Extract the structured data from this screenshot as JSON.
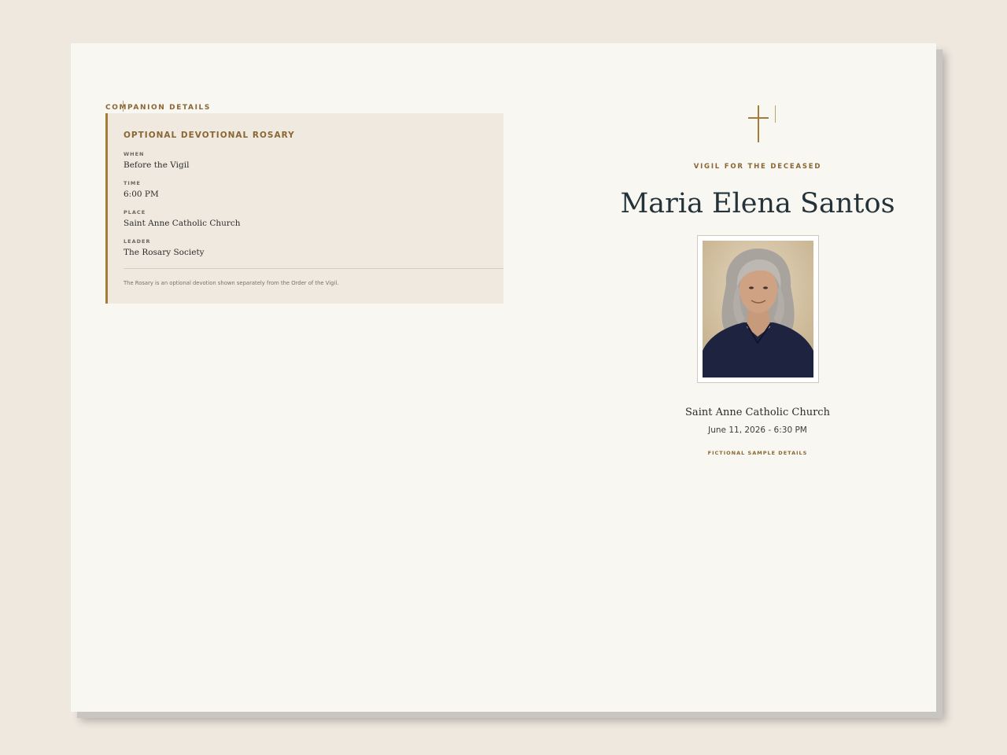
{
  "companion": {
    "section_label": "COMPANION DETAILS",
    "card": {
      "title": "OPTIONAL DEVOTIONAL ROSARY",
      "fields": [
        {
          "label": "WHEN",
          "value": "Before the Vigil"
        },
        {
          "label": "TIME",
          "value": "6:00 PM"
        },
        {
          "label": "PLACE",
          "value": "Saint Anne Catholic Church"
        },
        {
          "label": "LEADER",
          "value": "The Rosary Society"
        }
      ],
      "note": "The Rosary is an optional devotion shown separately from the Order of the Vigil."
    }
  },
  "cover": {
    "icon": "cross-icon",
    "kicker": "VIGIL FOR THE DECEASED",
    "name": "Maria Elena Santos",
    "photo_icon": "portrait-photo",
    "church": "Saint Anne Catholic Church",
    "date_time": "June 11, 2026 - 6:30 PM",
    "footnote": "FICTIONAL SAMPLE DETAILS"
  },
  "colors": {
    "background": "#efe8df",
    "paper": "#f9f7f1",
    "accent": "#a77b3a",
    "card": "#f0e9df",
    "title_text": "#24333a"
  }
}
